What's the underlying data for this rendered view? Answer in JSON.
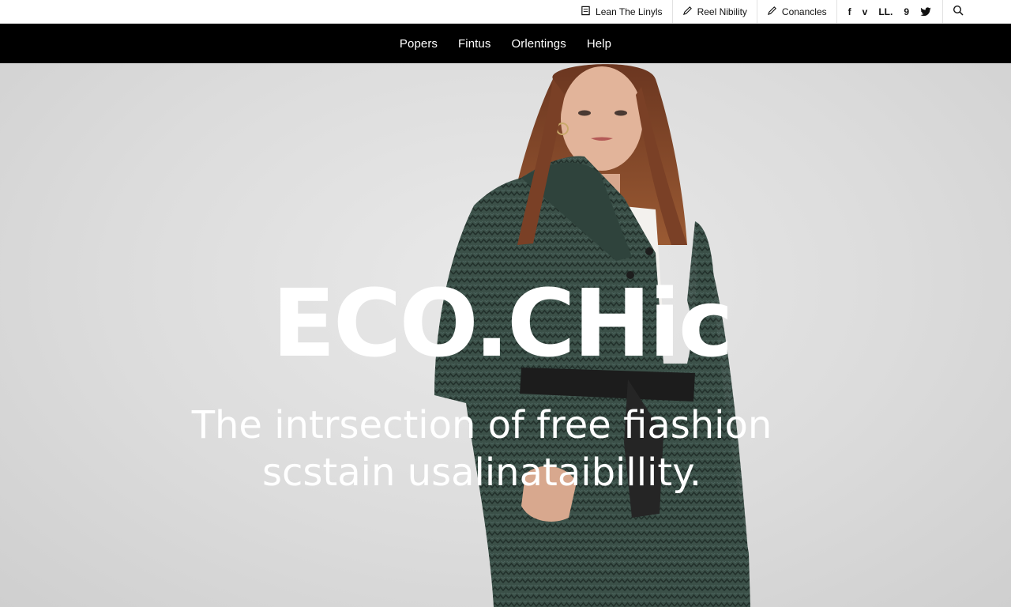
{
  "utility_bar": {
    "links": [
      {
        "label": "Lean The Linyls",
        "icon": "document-icon"
      },
      {
        "label": "Reel Nibility",
        "icon": "pen-icon"
      },
      {
        "label": "Conancles",
        "icon": "pen-icon"
      }
    ],
    "social": [
      "f",
      "v",
      "LL.",
      "9"
    ],
    "search_icon": "search-icon"
  },
  "nav": {
    "items": [
      "Popers",
      "Fintus",
      "Orlentings",
      "Help"
    ]
  },
  "hero": {
    "title": "ECO.CHic",
    "tagline_line1": "The intrsection of free fiashion",
    "tagline_line2": "scstain usalinataibillity.",
    "colors": {
      "background": "#dcdcdc",
      "coat": "#3b5048",
      "hair": "#8a4a2a",
      "belt": "#1c1c1c",
      "text": "#ffffff"
    }
  }
}
